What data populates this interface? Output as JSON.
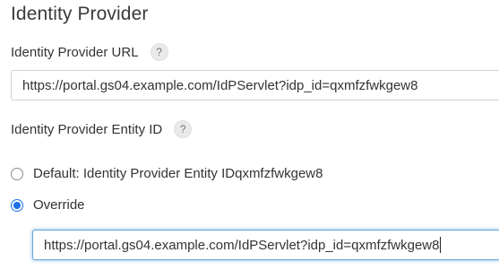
{
  "section": {
    "title": "Identity Provider"
  },
  "idp_url": {
    "label": "Identity Provider URL",
    "help": "?",
    "value": "https://portal.gs04.example.com/IdPServlet?idp_id=qxmfzfwkgew8"
  },
  "entity_id": {
    "label": "Identity Provider Entity ID",
    "help": "?",
    "options": [
      {
        "label": "Default: Identity Provider Entity IDqxmfzfwkgew8",
        "selected": false
      },
      {
        "label": "Override",
        "selected": true
      }
    ],
    "override_value": "https://portal.gs04.example.com/IdPServlet?idp_id=qxmfzfwkgew8"
  },
  "colors": {
    "accent": "#1a73e8",
    "focus_border": "#6aa6d6"
  }
}
